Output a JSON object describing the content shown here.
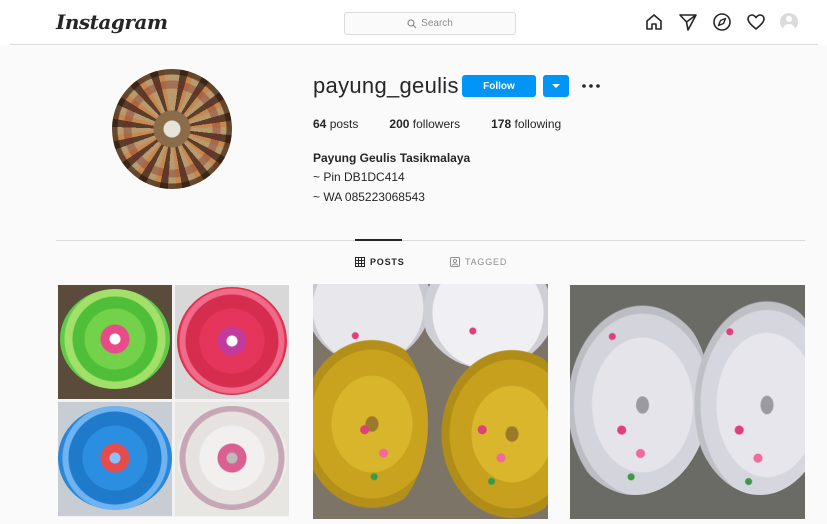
{
  "header": {
    "logo_text": "Instagram",
    "search_placeholder": "Search",
    "nav_icons": [
      "home-icon",
      "direct-icon",
      "explore-icon",
      "activity-heart-icon",
      "profile-avatar-icon"
    ]
  },
  "profile": {
    "username": "payung_geulis",
    "follow_label": "Follow",
    "stats": {
      "posts_count": "64",
      "posts_label": "posts",
      "followers_count": "200",
      "followers_label": "followers",
      "following_count": "178",
      "following_label": "following"
    },
    "bio": {
      "name": "Payung Geulis Tasikmalaya",
      "line1": "~ Pin DB1DC414",
      "line2": "~ WA 085223068543"
    }
  },
  "tabs": [
    {
      "label": "POSTS",
      "icon": "grid-icon",
      "active": true
    },
    {
      "label": "TAGGED",
      "icon": "tagged-icon",
      "active": false
    }
  ],
  "colors": {
    "accent": "#0095f6",
    "border": "#dbdbdb",
    "text": "#262626",
    "muted": "#8e8e8e"
  }
}
